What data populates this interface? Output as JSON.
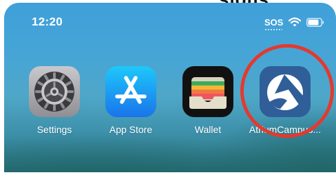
{
  "header_text": "sions",
  "status_bar": {
    "time": "12:20",
    "sos": "SOS",
    "wifi_icon": "wifi-icon",
    "battery_icon": "battery-icon"
  },
  "apps": [
    {
      "label": "Settings",
      "icon": "settings-gear-icon"
    },
    {
      "label": "App Store",
      "icon": "app-store-icon"
    },
    {
      "label": "Wallet",
      "icon": "wallet-icon"
    },
    {
      "label": "AtriumCampus...",
      "icon": "atrium-campus-icon"
    }
  ],
  "highlight": {
    "target": "AtriumCampus...",
    "color": "#e4392e"
  }
}
